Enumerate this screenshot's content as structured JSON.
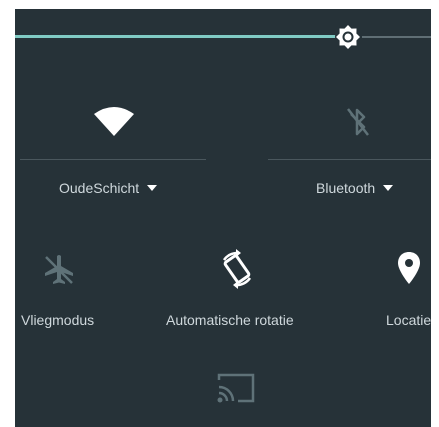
{
  "brightness": {
    "level": 0.8
  },
  "tiles": {
    "wifi": {
      "label": "OudeSchicht",
      "icon": "wifi-icon",
      "state": "on"
    },
    "bluetooth": {
      "label": "Bluetooth",
      "icon": "bluetooth-off-icon",
      "state": "off"
    },
    "airplane": {
      "label": "Vliegmodus",
      "icon": "airplane-off-icon",
      "state": "off"
    },
    "rotation": {
      "label": "Automatische rotatie",
      "icon": "auto-rotate-icon",
      "state": "on"
    },
    "location": {
      "label": "Locatie",
      "icon": "location-pin-icon",
      "state": "on"
    },
    "cast": {
      "icon": "cast-icon",
      "state": "off"
    }
  },
  "colors": {
    "panel_bg": "#263238",
    "accent": "#80cbc4",
    "icon_active": "#ffffff",
    "icon_inactive": "#5f7278",
    "label": "#cfd8dc"
  }
}
